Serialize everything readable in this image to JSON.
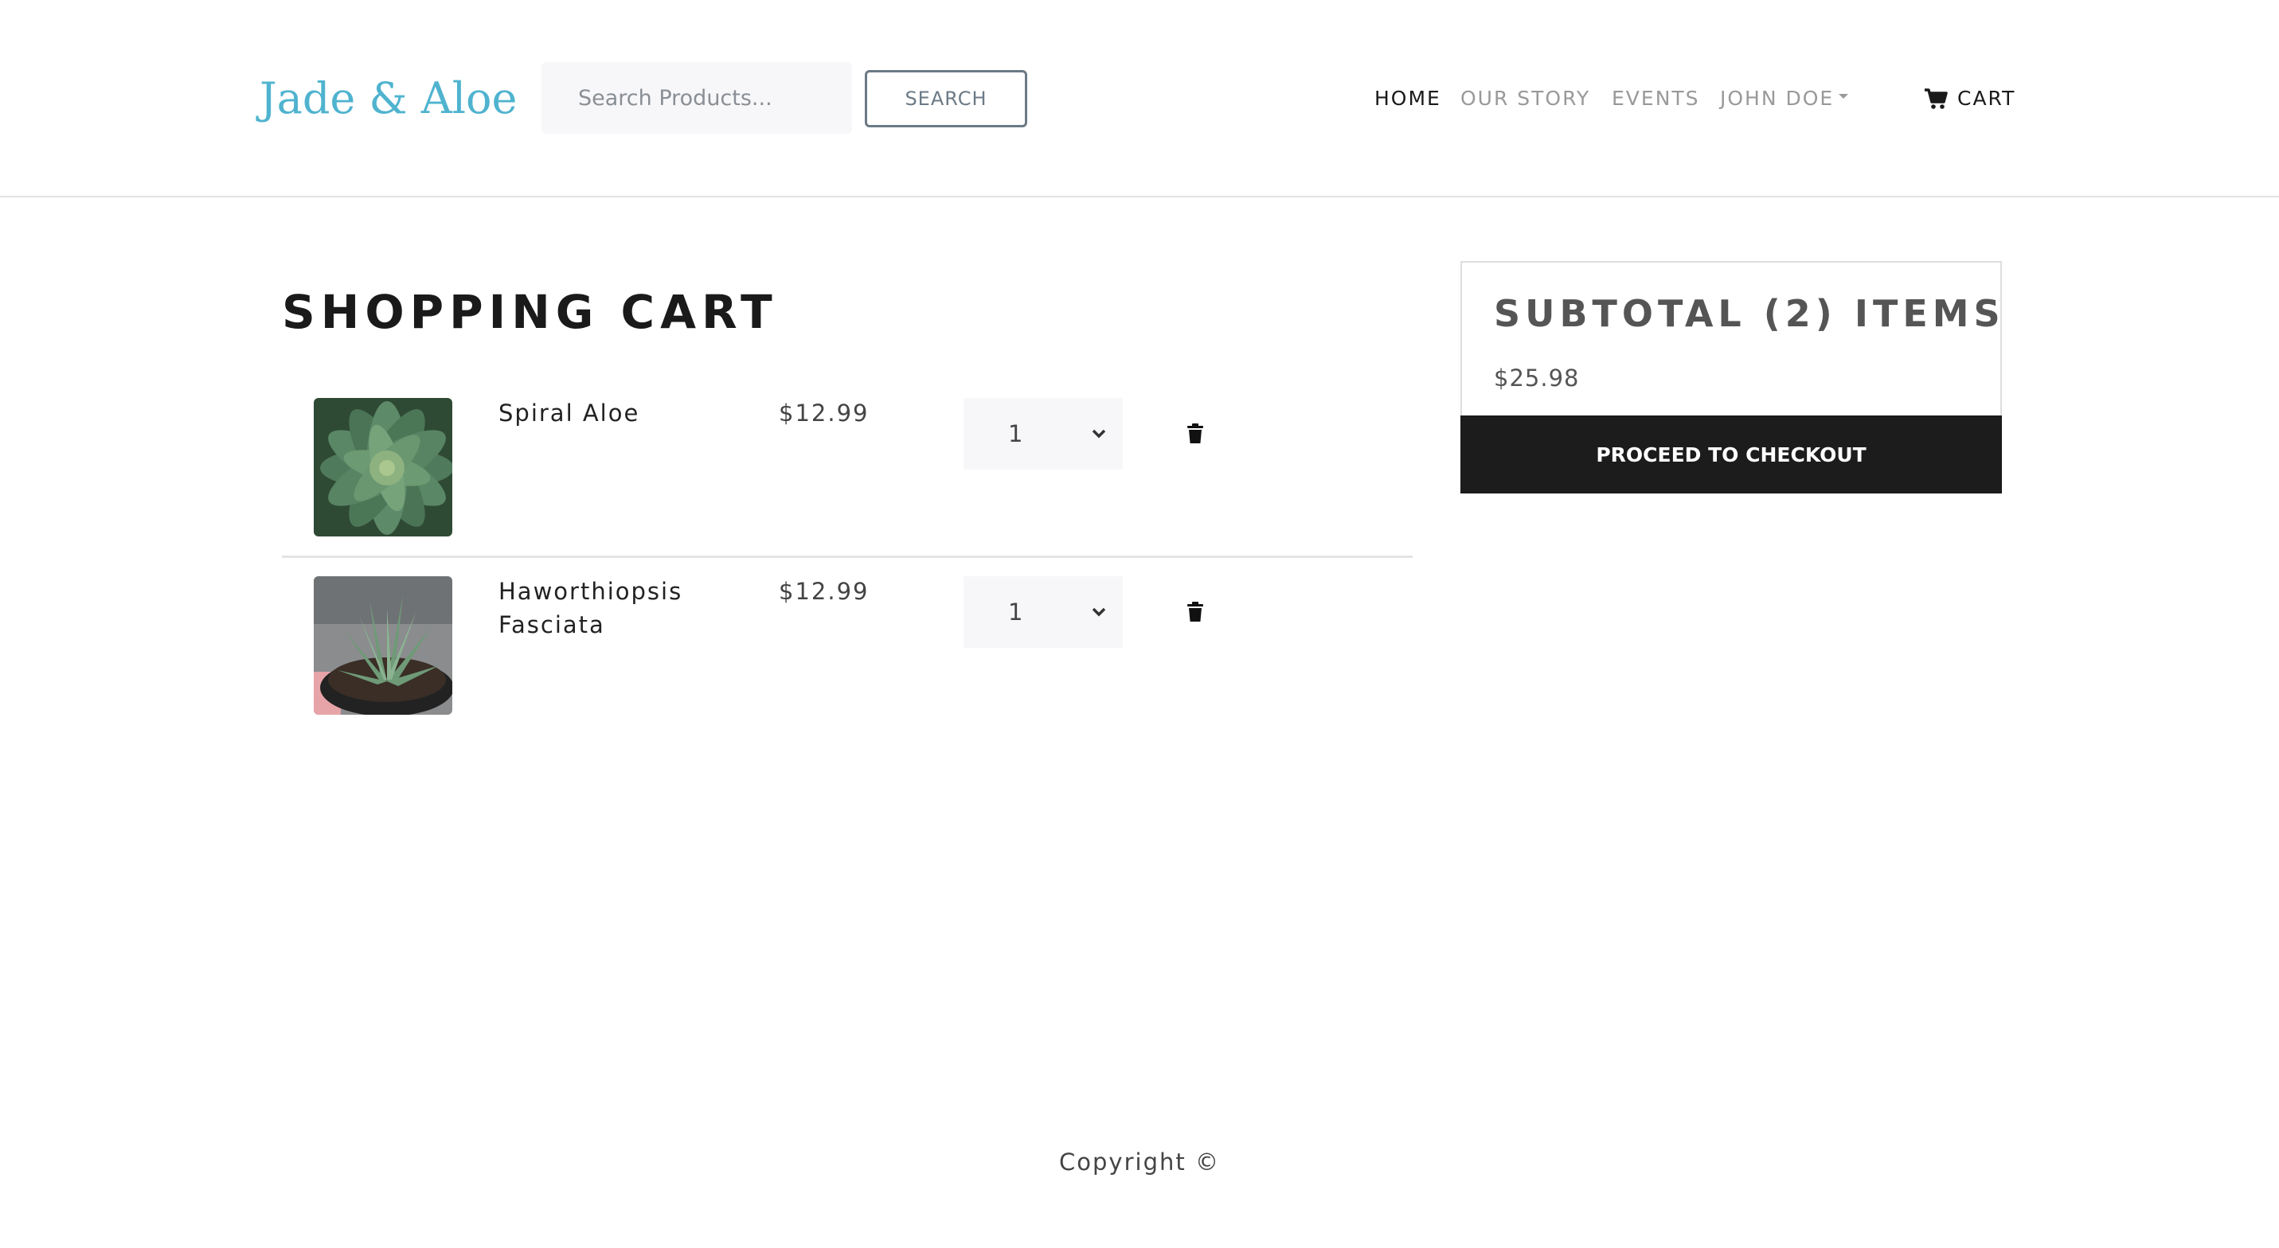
{
  "header": {
    "brand": "Jade & Aloe",
    "search": {
      "placeholder": "Search Products...",
      "value": "",
      "button_label": "SEARCH"
    },
    "nav": {
      "home": "HOME",
      "our_story": "OUR STORY",
      "events": "EVENTS",
      "user": "JOHN DOE",
      "cart": "CART"
    },
    "icons": {
      "cart": "shopping-cart-icon",
      "user_dropdown": "caret-down-icon"
    }
  },
  "main": {
    "title": "SHOPPING CART",
    "items": [
      {
        "name": "Spiral Aloe",
        "price": "$12.99",
        "quantity": "1",
        "image": "spiral-aloe-photo"
      },
      {
        "name": "Haworthiopsis Fasciata",
        "price": "$12.99",
        "quantity": "1",
        "image": "haworthiopsis-photo"
      }
    ],
    "icons": {
      "remove": "trash-icon",
      "select": "chevron-down-icon"
    }
  },
  "summary": {
    "title": "SUBTOTAL (2) ITEMS",
    "total": "$25.98",
    "checkout_label": "PROCEED TO CHECKOUT"
  },
  "footer": {
    "text": "Copyright ©"
  },
  "colors": {
    "brand": "#4fb3cf",
    "checkout_bg": "#1c1c1c",
    "field_bg": "#f7f7f9"
  }
}
